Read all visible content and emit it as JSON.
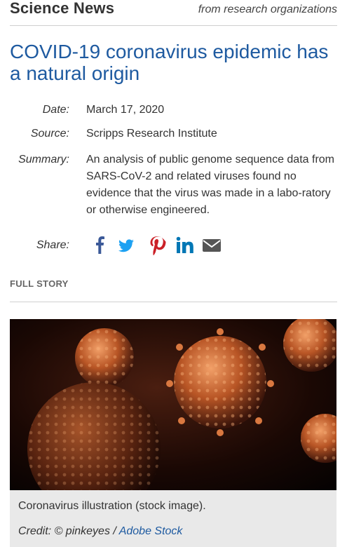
{
  "masthead": {
    "title": "Science News",
    "tagline": "from research organizations"
  },
  "article": {
    "headline": "COVID-19 coronavirus epidemic has a natural origin",
    "date_label": "Date:",
    "date": "March 17, 2020",
    "source_label": "Source:",
    "source": "Scripps Research Institute",
    "summary_label": "Summary:",
    "summary": "An analysis of public genome sequence data from SARS-CoV-2 and related viruses found no evidence that the virus was made in a labo-ratory or otherwise engineered."
  },
  "share": {
    "label": "Share:",
    "icons": [
      "facebook-icon",
      "twitter-icon",
      "pinterest-icon",
      "linkedin-icon",
      "email-icon"
    ]
  },
  "section_label": "FULL STORY",
  "figure": {
    "caption": "Coronavirus illustration (stock image).",
    "credit_prefix": "Credit: © pinkeyes / ",
    "credit_link": "Adobe Stock"
  },
  "colors": {
    "headline": "#1e5aa0",
    "facebook": "#3b5998",
    "twitter": "#1da1f2",
    "pinterest": "#cb2027",
    "linkedin": "#0077b5",
    "email": "#555555"
  }
}
